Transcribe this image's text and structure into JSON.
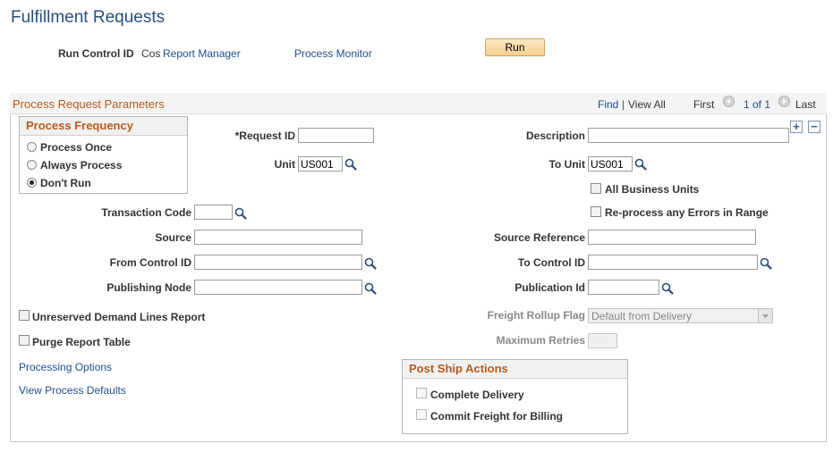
{
  "page": {
    "title": "Fulfillment Requests"
  },
  "header": {
    "run_control_label": "Run Control ID",
    "run_control_value": "Cos",
    "report_manager": "Report Manager",
    "process_monitor": "Process Monitor",
    "run_button": "Run"
  },
  "panel": {
    "title": "Process Request Parameters",
    "find": "Find",
    "separator": "|",
    "view_all": "View All",
    "first": "First",
    "pager": "1 of 1",
    "last": "Last",
    "add": "+",
    "remove": "−"
  },
  "frequency": {
    "title": "Process Frequency",
    "options": [
      "Process Once",
      "Always Process",
      "Don't Run"
    ],
    "selected": "Don't Run"
  },
  "fields": {
    "request_id_label": "*Request ID",
    "request_id_value": "",
    "description_label": "Description",
    "description_value": "",
    "unit_label": "Unit",
    "unit_value": "US001",
    "to_unit_label": "To Unit",
    "to_unit_value": "US001",
    "all_bu_label": "All Business Units",
    "reprocess_label": "Re-process any Errors in Range",
    "transaction_code_label": "Transaction Code",
    "transaction_code_value": "",
    "source_label": "Source",
    "source_reference_label": "Source Reference",
    "from_control_label": "From Control ID",
    "to_control_label": "To Control ID",
    "publishing_node_label": "Publishing Node",
    "publication_id_label": "Publication Id",
    "unreserved_label": "Unreserved Demand Lines Report",
    "freight_rollup_label": "Freight Rollup Flag",
    "freight_rollup_value": "Default from Delivery",
    "purge_label": "Purge Report Table",
    "max_retries_label": "Maximum Retries",
    "max_retries_value": ""
  },
  "links": {
    "processing_options": "Processing Options",
    "view_process_defaults": "View Process Defaults"
  },
  "post_ship": {
    "title": "Post Ship Actions",
    "complete_delivery": "Complete Delivery",
    "commit_freight": "Commit Freight for Billing"
  }
}
